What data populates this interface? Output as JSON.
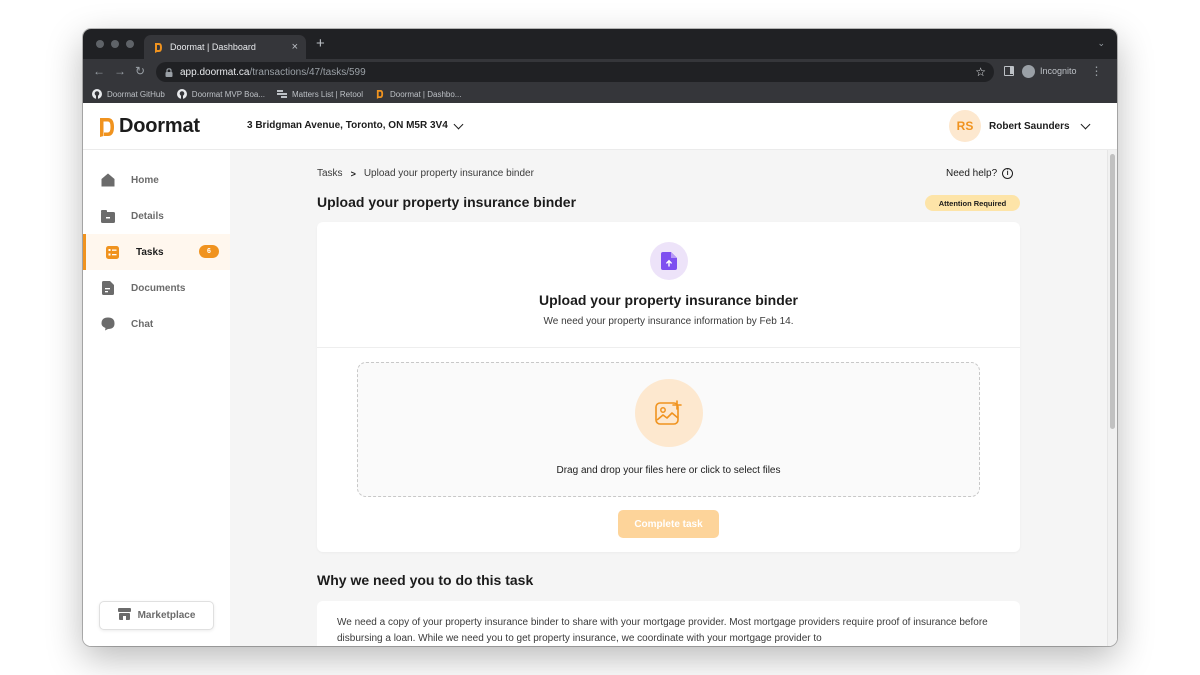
{
  "browser": {
    "tab_title": "Doormat | Dashboard",
    "new_tab_symbol": "+",
    "close_symbol": "×",
    "url_host": "app.doormat.ca",
    "url_path": "/transactions/47/tasks/599",
    "incognito_label": "Incognito",
    "bookmarks": [
      {
        "label": "Doormat GitHub",
        "icon": "github-icon"
      },
      {
        "label": "Doormat MVP Boa...",
        "icon": "github-icon"
      },
      {
        "label": "Matters List | Retool",
        "icon": "retool-icon"
      },
      {
        "label": "Doormat | Dashbo...",
        "icon": "doormat-icon"
      }
    ]
  },
  "header": {
    "logo_text": "Doormat",
    "property_address": "3 Bridgman Avenue, Toronto, ON M5R 3V4",
    "user_initials": "RS",
    "user_name": "Robert Saunders"
  },
  "sidebar": {
    "items": [
      {
        "label": "Home",
        "icon": "home-icon",
        "active": false
      },
      {
        "label": "Details",
        "icon": "folder-icon",
        "active": false
      },
      {
        "label": "Tasks",
        "icon": "checklist-icon",
        "active": true,
        "badge": "6"
      },
      {
        "label": "Documents",
        "icon": "document-icon",
        "active": false
      },
      {
        "label": "Chat",
        "icon": "chat-icon",
        "active": false
      }
    ],
    "marketplace_label": "Marketplace"
  },
  "main": {
    "breadcrumb_parent": "Tasks",
    "breadcrumb_separator": ">",
    "breadcrumb_current": "Upload your property insurance binder",
    "help_label": "Need help?",
    "page_title": "Upload your property insurance binder",
    "status_badge": "Attention Required",
    "card_title": "Upload your property insurance binder",
    "card_subtitle": "We need your property insurance information by Feb 14.",
    "dropzone_text": "Drag and drop your files here or click to select files",
    "complete_button": "Complete task",
    "why_title": "Why we need you to do this task",
    "why_body": "We need a copy of your property insurance binder to share with your mortgage provider. Most mortgage providers require proof of insurance before disbursing a loan. While we need you to get property insurance, we coordinate with your mortgage provider to"
  },
  "colors": {
    "accent": "#f0931f",
    "accent_light": "#fde8cf",
    "status_bg": "#fde4a8",
    "doc_purple": "#7e4ff0"
  }
}
